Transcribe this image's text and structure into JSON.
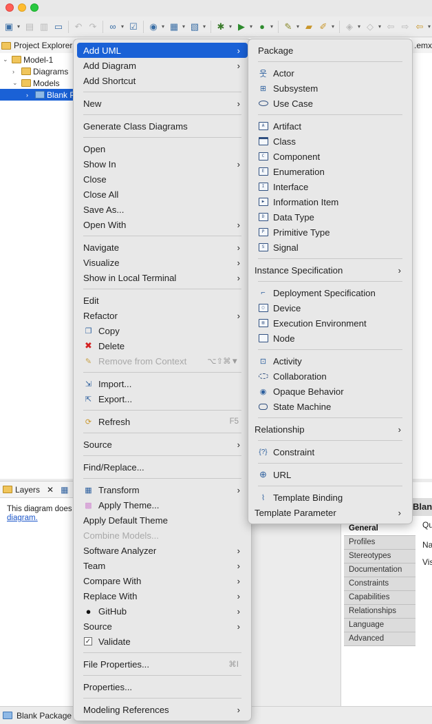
{
  "toolbar": {
    "icons": [
      "new-wizard-icon",
      "save-icon",
      "save-all-icon",
      "print-icon",
      "undo-icon",
      "redo-icon",
      "binoculars-icon",
      "checklist-icon",
      "publish-icon",
      "new-model-icon",
      "new-project-icon",
      "debug-icon",
      "run-icon",
      "external-tools-icon",
      "marker-icon",
      "open-folder-icon",
      "pen-icon",
      "navigate-icon",
      "history-icon",
      "back-icon",
      "forward-icon"
    ]
  },
  "explorer": {
    "tab_label": "Project Explorer",
    "right_tab_label": ".emx",
    "tree": [
      {
        "label": "Model-1"
      },
      {
        "label": "Diagrams"
      },
      {
        "label": "Models"
      },
      {
        "label": "Blank P"
      }
    ]
  },
  "main_menu": {
    "items": [
      {
        "label": "Add UML",
        "arrow": "›"
      },
      {
        "label": "Add Diagram",
        "arrow": "›"
      },
      {
        "label": "Add Shortcut"
      },
      {
        "label": "New",
        "arrow": "›"
      },
      {
        "label": "Generate Class Diagrams"
      },
      {
        "label": "Open"
      },
      {
        "label": "Show In",
        "arrow": "›"
      },
      {
        "label": "Close"
      },
      {
        "label": "Close All"
      },
      {
        "label": "Save As..."
      },
      {
        "label": "Open With",
        "arrow": "›"
      },
      {
        "label": "Navigate",
        "arrow": "›"
      },
      {
        "label": "Visualize",
        "arrow": "›"
      },
      {
        "label": "Show in Local Terminal",
        "arrow": "›"
      },
      {
        "label": "Edit"
      },
      {
        "label": "Refactor",
        "arrow": "›"
      },
      {
        "label": "Copy"
      },
      {
        "label": "Delete",
        "icon": "✖"
      },
      {
        "label": "Remove from Context",
        "shortcut": "⌥⇧⌘▼"
      },
      {
        "label": "Import..."
      },
      {
        "label": "Export..."
      },
      {
        "label": "Refresh",
        "shortcut": "F5"
      },
      {
        "label": "Source",
        "arrow": "›"
      },
      {
        "label": "Find/Replace..."
      },
      {
        "label": "Transform",
        "arrow": "›"
      },
      {
        "label": "Apply Theme..."
      },
      {
        "label": "Apply Default Theme"
      },
      {
        "label": "Combine Models..."
      },
      {
        "label": "Software Analyzer",
        "arrow": "›"
      },
      {
        "label": "Team",
        "arrow": "›"
      },
      {
        "label": "Compare With",
        "arrow": "›"
      },
      {
        "label": "Replace With",
        "arrow": "›"
      },
      {
        "label": "GitHub",
        "arrow": "›"
      },
      {
        "label": "Source",
        "arrow": "›"
      },
      {
        "label": "Validate",
        "icon": "✓"
      },
      {
        "label": "File Properties...",
        "shortcut": "⌘I"
      },
      {
        "label": "Properties..."
      },
      {
        "label": "Modeling References",
        "arrow": "›"
      }
    ]
  },
  "sub_menu": {
    "items": [
      {
        "label": "Package"
      },
      {
        "label": "Actor",
        "icon": "웃"
      },
      {
        "label": "Subsystem"
      },
      {
        "label": "Use Case"
      },
      {
        "label": "Artifact",
        "icon": "A"
      },
      {
        "label": "Class"
      },
      {
        "label": "Component",
        "icon": "C"
      },
      {
        "label": "Enumeration",
        "icon": "E"
      },
      {
        "label": "Interface",
        "icon": "I"
      },
      {
        "label": "Information Item"
      },
      {
        "label": "Data Type",
        "icon": "D"
      },
      {
        "label": "Primitive Type",
        "icon": "P"
      },
      {
        "label": "Signal",
        "icon": "S"
      },
      {
        "label": "Instance Specification",
        "arrow": "›"
      },
      {
        "label": "Deployment Specification"
      },
      {
        "label": "Device"
      },
      {
        "label": "Execution Environment"
      },
      {
        "label": "Node"
      },
      {
        "label": "Activity"
      },
      {
        "label": "Collaboration"
      },
      {
        "label": "Opaque Behavior"
      },
      {
        "label": "State Machine"
      },
      {
        "label": "Relationship",
        "arrow": "›"
      },
      {
        "label": "Constraint",
        "icon": "{?}"
      },
      {
        "label": "URL"
      },
      {
        "label": "Template Binding"
      },
      {
        "label": "Template Parameter",
        "arrow": "›"
      }
    ]
  },
  "layers": {
    "tab_label": "Layers",
    "close_glyph": "✕",
    "message": "This diagram does",
    "link": "diagram."
  },
  "properties": {
    "header": "Blan",
    "labels": [
      "Qu",
      "Na",
      "Vis"
    ],
    "tabs": [
      "General",
      "Profiles",
      "Stereotypes",
      "Documentation",
      "Constraints",
      "Capabilities",
      "Relationships",
      "Language",
      "Advanced"
    ]
  },
  "status": {
    "label": "Blank Package"
  }
}
